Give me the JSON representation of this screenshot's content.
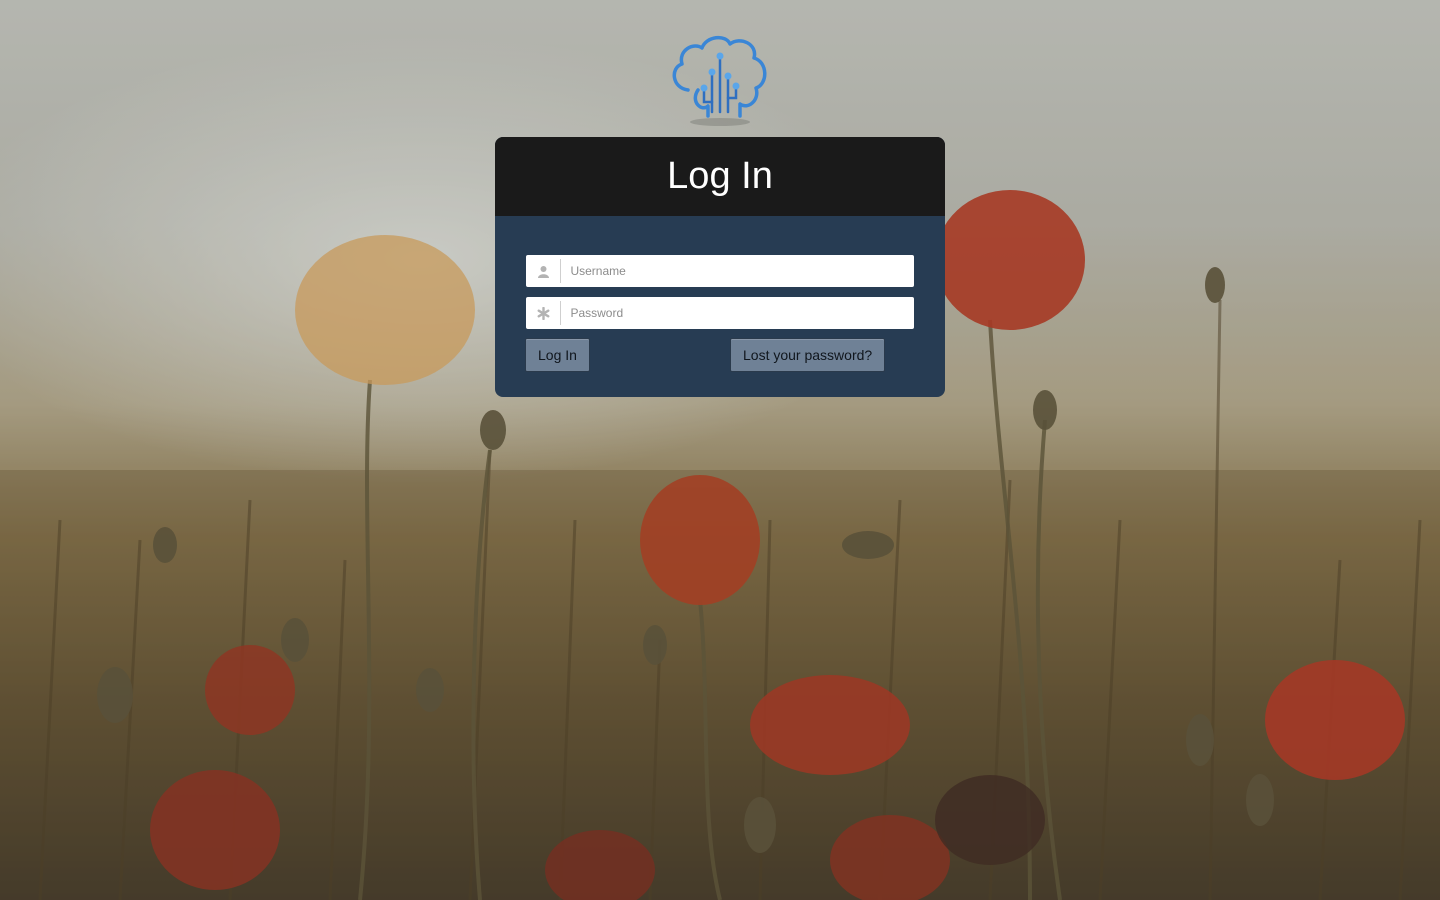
{
  "page": {
    "title": "Log In"
  },
  "form": {
    "username_placeholder": "Username",
    "password_placeholder": "Password",
    "username_icon": "user-icon",
    "password_icon": "asterisk-icon",
    "submit_label": "Log In",
    "lost_password_label": "Lost your password?"
  },
  "colors": {
    "header_bg": "#1a1a1a",
    "panel_bg": "#273c53",
    "button_bg": "#6f8196",
    "logo_blue": "#3a86d6"
  },
  "logo": {
    "icon": "brain-circuit-logo"
  }
}
